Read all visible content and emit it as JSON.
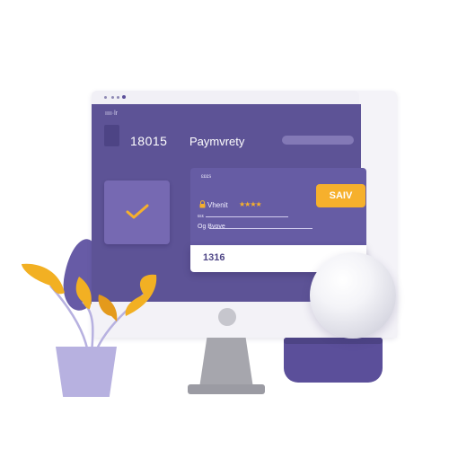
{
  "window": {
    "menu_text": "ıııı·lr"
  },
  "header": {
    "number": "18015",
    "title": "Paymvrety"
  },
  "card": {
    "small_label": "ɛɛɛs",
    "holder_name": "Vhenit",
    "rating_stars": "★★★★",
    "field1_label": "ɛɛɛ",
    "field2_label": "Og  Bvove",
    "save_label": "SAIV",
    "code": "1316"
  },
  "colors": {
    "screen": "#5d5396",
    "card": "#665ca4",
    "accent": "#f6b02c",
    "check": "#f6b02c",
    "pot": "#b7b1e0"
  },
  "icons": [
    "check-icon",
    "lock-icon",
    "document-icon"
  ]
}
